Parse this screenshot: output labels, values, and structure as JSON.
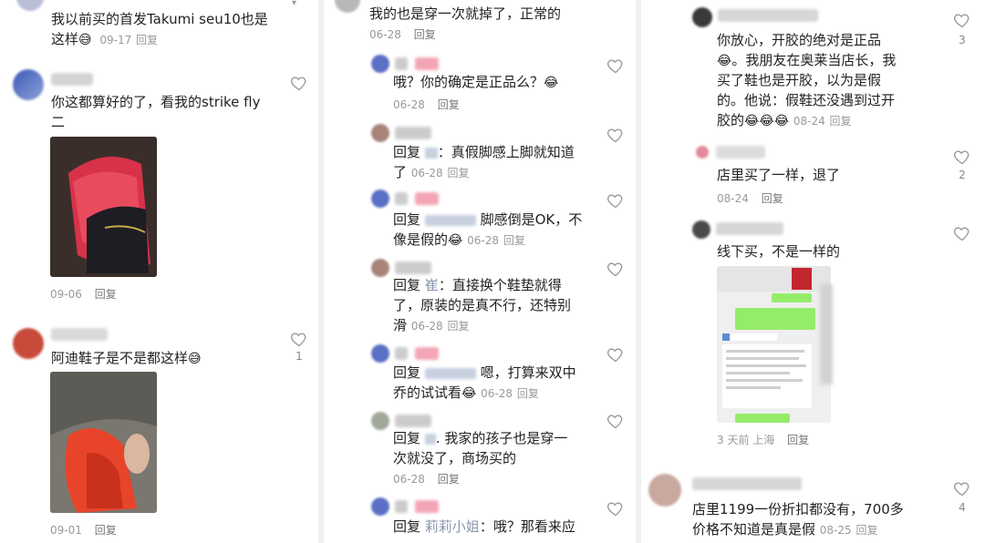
{
  "panel1": {
    "c1": {
      "text_a": "我以前买的首发Takumi seu10也是",
      "text_b": "这样",
      "emoji": "😅",
      "date": "09-17",
      "reply": "回复"
    },
    "c2": {
      "text_a": "你这都算好的了，看我的strike fly",
      "text_b": "二",
      "date": "09-06",
      "reply": "回复"
    },
    "c3": {
      "text": "阿迪鞋子是不是都这样",
      "emoji": "😅",
      "date": "09-01",
      "reply": "回复",
      "likes": "1"
    }
  },
  "panel2": {
    "c1": {
      "text": "我的也是穿一次就掉了，正常的",
      "date": "06-28",
      "reply": "回复"
    },
    "c2": {
      "text": "哦？你的确定是正品么？",
      "emoji": "😂",
      "date": "06-28",
      "reply": "回复"
    },
    "c3": {
      "prefix": "回复",
      "text_a": "：真假脚感上脚就知道",
      "text_b": "了",
      "date": "06-28",
      "reply": "回复"
    },
    "c4": {
      "prefix": "回复",
      "text_a": "脚感倒是OK，不",
      "text_b": "像是假的",
      "emoji": "😂",
      "date": "06-28",
      "reply": "回复"
    },
    "c5": {
      "prefix": "回复",
      "quote": "崔",
      "text_a": "：直接换个鞋垫就得",
      "text_b": "了，原装的是真不行，还特别",
      "text_c": "滑",
      "date": "06-28",
      "reply": "回复"
    },
    "c6": {
      "prefix": "回复",
      "text_a": "嗯，打算来双中",
      "text_b": "乔的试试看",
      "emoji": "😂",
      "date": "06-28",
      "reply": "回复"
    },
    "c7": {
      "prefix": "回复",
      "text_a": ". 我家的孩子也是穿一",
      "text_b": "次就没了，商场买的",
      "date": "06-28",
      "reply": "回复"
    },
    "c8": {
      "prefix": "回复",
      "quote": "莉莉小姐",
      "text": "：哦？那看来应"
    }
  },
  "panel3": {
    "c1": {
      "text_a": "你放心，开胶的绝对是正品",
      "text_b": "。我朋友在奥莱当店长，我",
      "text_c": "买了鞋也是开胶，以为是假",
      "text_d": "的。他说：假鞋还没遇到过开",
      "text_e": "胶的",
      "emoji": "😂",
      "date": "08-24",
      "reply": "回复",
      "likes": "3"
    },
    "c2": {
      "text": "店里买了一样，退了",
      "date": "08-24",
      "reply": "回复",
      "likes": "2"
    },
    "c3": {
      "text": "线下买，不是一样的",
      "meta": "3 天前 上海",
      "reply": "回复"
    },
    "c4": {
      "text_a": "店里1199一份折扣都没有，700多",
      "text_b": "价格不知道是真是假",
      "date": "08-25",
      "reply": "回复",
      "likes": "4"
    }
  },
  "colors": {
    "text": "#222222",
    "meta": "#999999",
    "heart": "#9a9a9a",
    "quote": "#8a96b0"
  }
}
